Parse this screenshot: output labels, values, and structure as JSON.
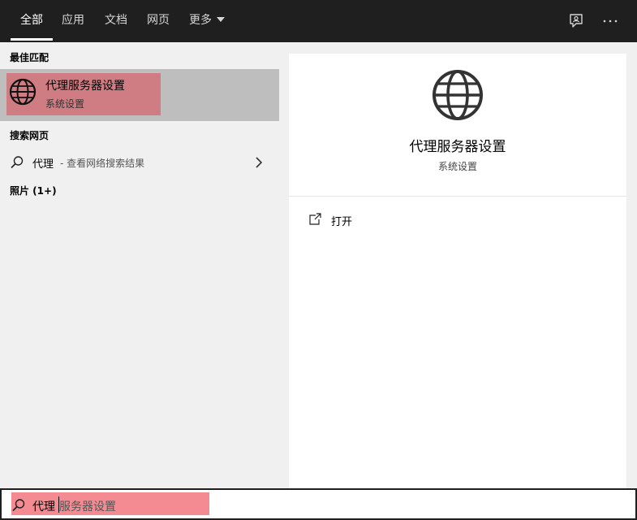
{
  "tabs": [
    {
      "label": "全部",
      "active": true
    },
    {
      "label": "应用"
    },
    {
      "label": "文档"
    },
    {
      "label": "网页"
    },
    {
      "label": "更多"
    }
  ],
  "icons": {
    "feedback": "feedback-icon",
    "more": "more-options-icon",
    "globe": "globe-icon",
    "search": "search-icon",
    "chevron": "chevron-right-icon",
    "open": "open-icon"
  },
  "left": {
    "best_match_title": "最佳匹配",
    "best_match": {
      "title": "代理服务器设置",
      "subtitle": "系统设置"
    },
    "web_title": "搜索网页",
    "web_result": {
      "query": "代理",
      "hint": "- 查看网络搜索结果"
    },
    "photos_title": "照片 (1+)"
  },
  "detail": {
    "title": "代理服务器设置",
    "subtitle": "系统设置",
    "actions": [
      {
        "label": "打开"
      }
    ]
  },
  "search": {
    "typed": "代理",
    "suggestion": "服务器设置"
  },
  "colors": {
    "topbar": "#1f1f1f",
    "selected_row": "#bebebe",
    "highlight": "#dc4650"
  }
}
